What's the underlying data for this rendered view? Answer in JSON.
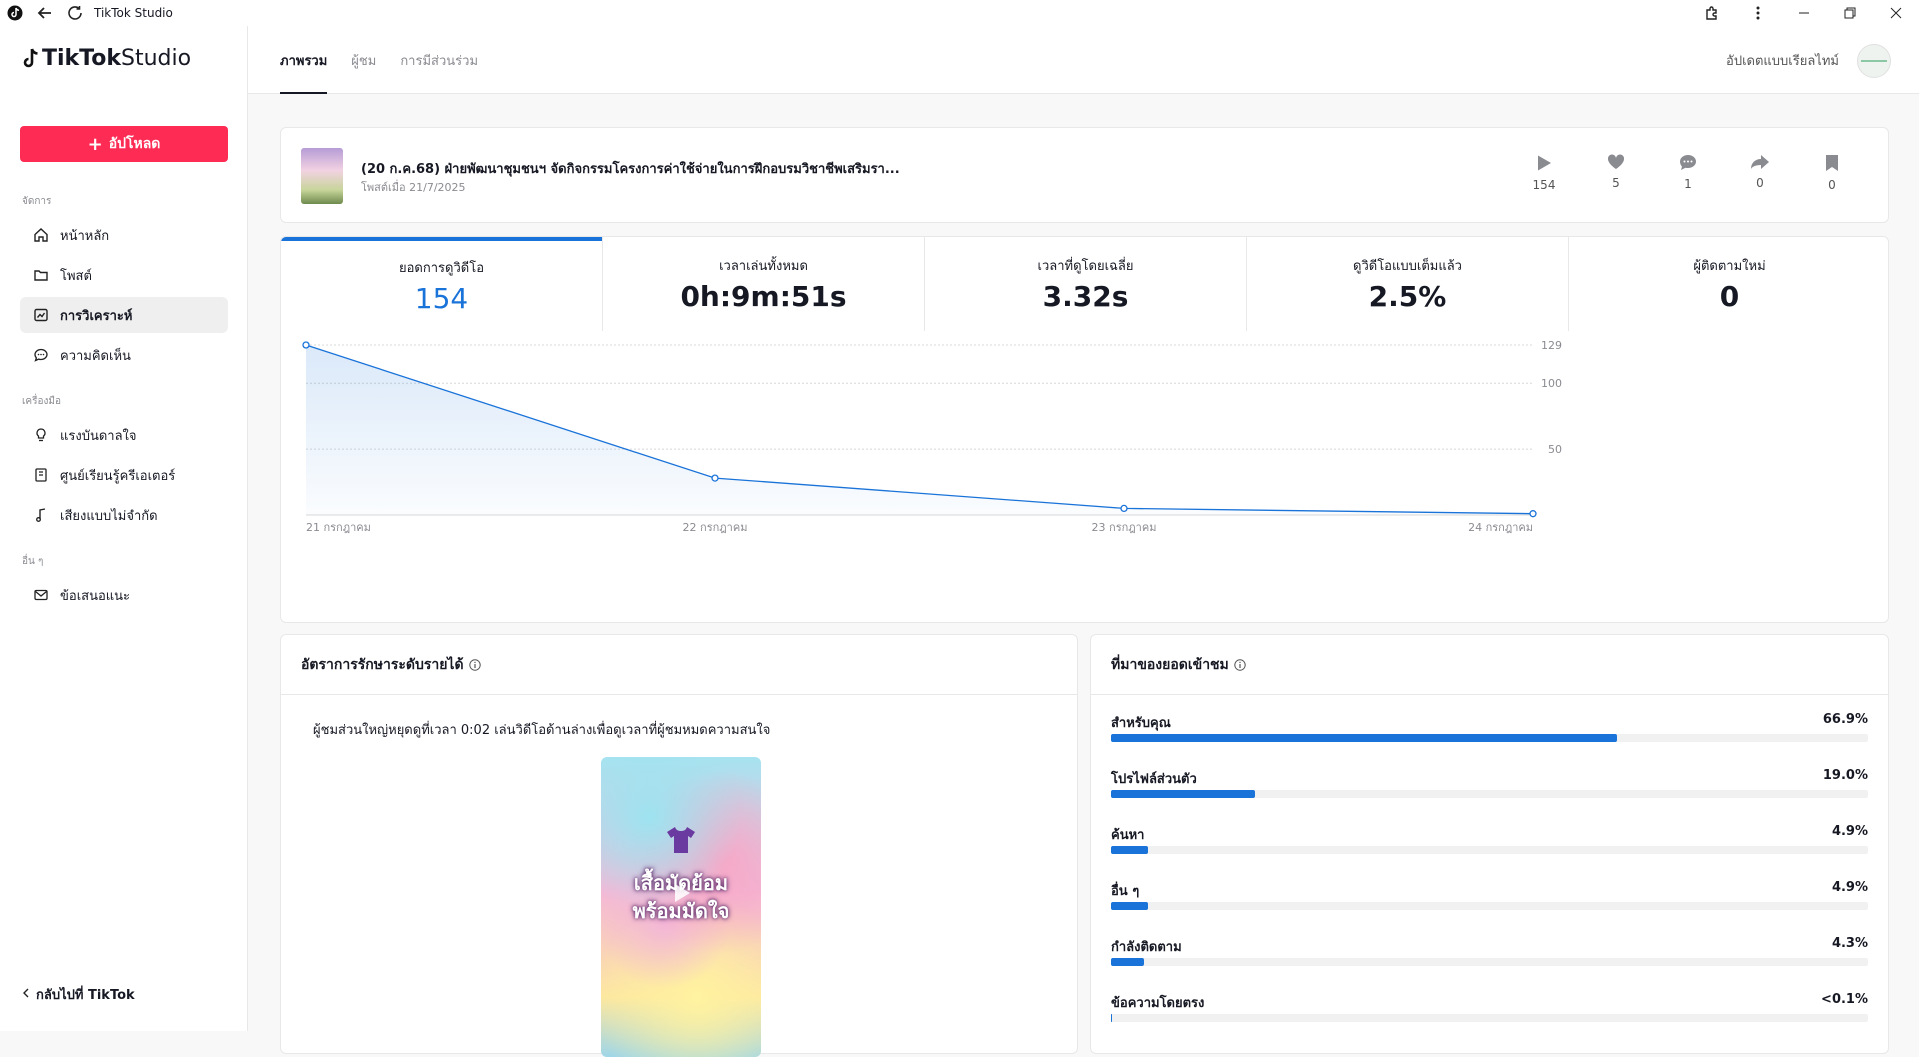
{
  "window": {
    "title": "TikTok Studio"
  },
  "sidebar": {
    "logo_tiktok": "TikTok",
    "logo_studio": " Studio",
    "upload_label": "อัปโหลด",
    "sections": [
      {
        "label": "จัดการ",
        "items": [
          {
            "label": "หน้าหลัก",
            "icon": "home-icon"
          },
          {
            "label": "โพสต์",
            "icon": "folder-icon"
          },
          {
            "label": "การวิเคราะห์",
            "icon": "analytics-icon",
            "active": true
          },
          {
            "label": "ความคิดเห็น",
            "icon": "comment-icon"
          }
        ]
      },
      {
        "label": "เครื่องมือ",
        "items": [
          {
            "label": "แรงบันดาลใจ",
            "icon": "lightbulb-icon"
          },
          {
            "label": "ศูนย์เรียนรู้ครีเอเตอร์",
            "icon": "book-icon"
          },
          {
            "label": "เสียงแบบไม่จำกัด",
            "icon": "music-note-icon"
          }
        ]
      },
      {
        "label": "อื่น ๆ",
        "items": [
          {
            "label": "ข้อเสนอแนะ",
            "icon": "mail-icon"
          }
        ]
      }
    ],
    "back_label": "กลับไปที่ TikTok"
  },
  "header": {
    "tabs": [
      {
        "label": "ภาพรวม",
        "active": true
      },
      {
        "label": "ผู้ชม"
      },
      {
        "label": "การมีส่วนร่วม"
      }
    ],
    "realtime_label": "อัปเดตแบบเรียลไทม์"
  },
  "post": {
    "title": "(20 ก.ค.68) ฝ่ายพัฒนาชุมชนฯ จัดกิจกรรมโครงการค่าใช้จ่ายในการฝึกอบรมวิชาชีพเสริมรา...",
    "date": "โพสต์เมื่อ 21/7/2025",
    "stats": {
      "views": "154",
      "likes": "5",
      "comments": "1",
      "shares": "0",
      "saves": "0"
    }
  },
  "metrics": [
    {
      "label": "ยอดการดูวิดีโอ",
      "value": "154"
    },
    {
      "label": "เวลาเล่นทั้งหมด",
      "value": "0h:9m:51s"
    },
    {
      "label": "เวลาที่ดูโดยเฉลี่ย",
      "value": "3.32s"
    },
    {
      "label": "ดูวิดีโอแบบเต็มแล้ว",
      "value": "2.5%"
    },
    {
      "label": "ผู้ติดตามใหม่",
      "value": "0"
    }
  ],
  "chart_data": {
    "type": "area",
    "categories": [
      "21 กรกฎาคม",
      "22 กรกฎาคม",
      "23 กรกฎาคม",
      "24 กรกฎาคม"
    ],
    "values": [
      129,
      28,
      5,
      1
    ],
    "yticks": [
      129,
      100,
      50
    ],
    "ylim": [
      0,
      129
    ],
    "grid": true,
    "color": "#1a73d9"
  },
  "retention": {
    "title": "อัตราการรักษาระดับรายได้",
    "text": "ผู้ชมส่วนใหญ่หยุดดูที่เวลา 0:02 เล่นวิดีโอด้านล่างเพื่อดูเวลาที่ผู้ชมหมดความสนใจ",
    "video_line1": "เสื้อมัดย้อม",
    "video_line2": "พร้อมมัดใจ"
  },
  "traffic": {
    "title": "ที่มาของยอดเข้าชม",
    "sources": [
      {
        "label": "สำหรับคุณ",
        "pct": "66.9%",
        "value": 66.9
      },
      {
        "label": "โปรไฟล์ส่วนตัว",
        "pct": "19.0%",
        "value": 19.0
      },
      {
        "label": "ค้นหา",
        "pct": "4.9%",
        "value": 4.9
      },
      {
        "label": "อื่น ๆ",
        "pct": "4.9%",
        "value": 4.9
      },
      {
        "label": "กำลังติดตาม",
        "pct": "4.3%",
        "value": 4.3
      },
      {
        "label": "ข้อความโดยตรง",
        "pct": "<0.1%",
        "value": 0.1
      }
    ]
  }
}
